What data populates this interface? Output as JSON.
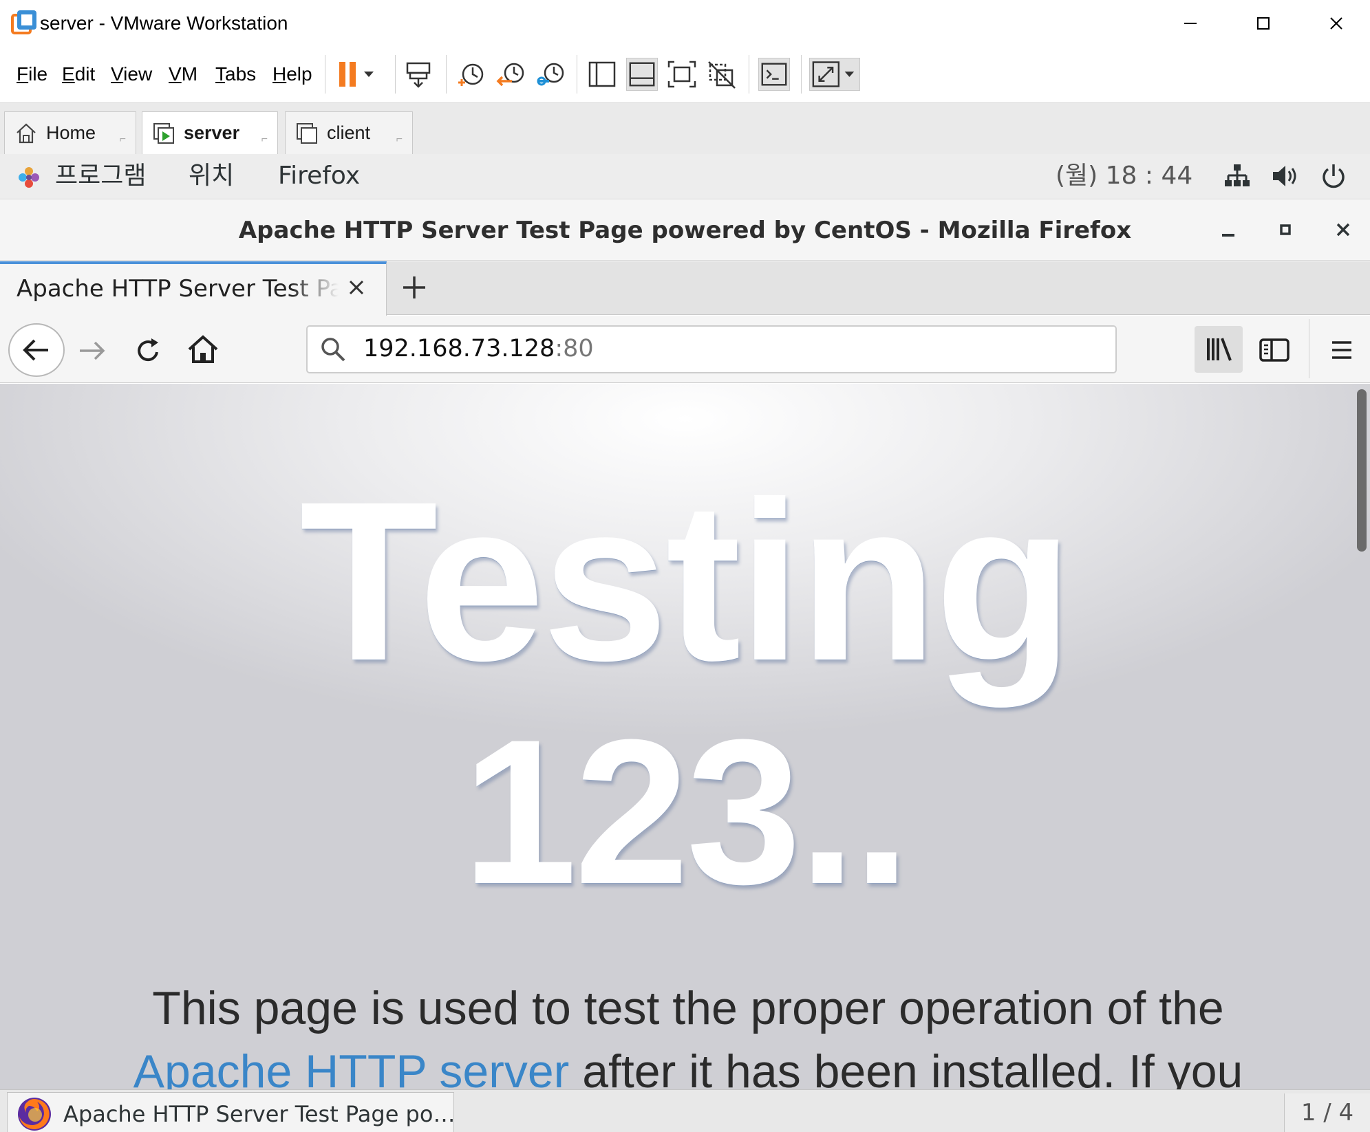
{
  "window": {
    "title": "server - VMware Workstation"
  },
  "vmware_menu": {
    "file": {
      "accel": "F",
      "rest": "ile"
    },
    "edit": {
      "accel": "E",
      "rest": "dit"
    },
    "view": {
      "accel": "V",
      "rest": "iew"
    },
    "vm": {
      "accel": "V",
      "rest": "M"
    },
    "tabs": {
      "accel": "T",
      "rest": "abs"
    },
    "help": {
      "accel": "H",
      "rest": "elp"
    }
  },
  "vmware_tabs": [
    {
      "label": "Home",
      "active": false
    },
    {
      "label": "server",
      "active": true
    },
    {
      "label": "client",
      "active": false
    }
  ],
  "gnome_top": {
    "programs": "프로그램",
    "places": "위치",
    "app": "Firefox",
    "clock": "(월) 18 : 44"
  },
  "firefox": {
    "window_title": "Apache HTTP Server Test Page powered by CentOS - Mozilla Firefox",
    "tab_title": "Apache HTTP Server Test Page powered by CentOS",
    "url_host": "192.168.73.128",
    "url_port": ":80"
  },
  "page": {
    "hero_line1": "Testing",
    "hero_line2": "123..",
    "text_before_link": "This page is used to test the proper operation of the",
    "link_text": "Apache HTTP server",
    "text_after_link": " after it has been installed. If you"
  },
  "gnome_bottom": {
    "task_label": "Apache HTTP Server Test Page po…",
    "workspace": "1 / 4"
  },
  "colors": {
    "accent_blue": "#4a90d9",
    "link_blue": "#3a86c8",
    "vmware_orange": "#f47b20"
  }
}
